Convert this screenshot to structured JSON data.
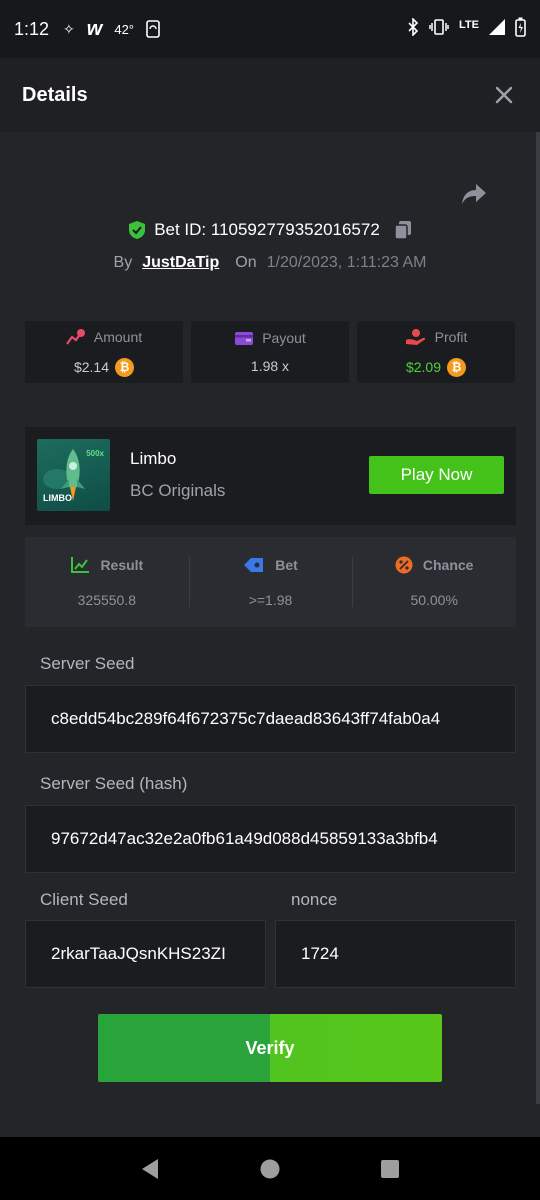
{
  "status_bar": {
    "time": "1:12",
    "temp": "42°",
    "network": "LTE"
  },
  "header": {
    "title": "Details"
  },
  "bet": {
    "id_label": "Bet ID: 110592779352016572",
    "by_label": "By",
    "user": "JustDaTip",
    "on_label": "On",
    "date": "1/20/2023, 1:11:23 AM"
  },
  "stats": [
    {
      "label": "Amount",
      "value": "$2.14",
      "icon": "money-bag-icon",
      "currency_icon": true
    },
    {
      "label": "Payout",
      "value": "1.98 x",
      "icon": "wallet-icon",
      "currency_icon": false
    },
    {
      "label": "Profit",
      "value": "$2.09",
      "icon": "hand-coin-icon",
      "currency_icon": true
    }
  ],
  "game": {
    "name": "Limbo",
    "provider": "BC Originals",
    "thumb_label": "LIMBO",
    "thumb_multiplier": "500x",
    "play_label": "Play Now"
  },
  "results": [
    {
      "label": "Result",
      "value": "325550.8"
    },
    {
      "label": "Bet",
      "value": ">=1.98"
    },
    {
      "label": "Chance",
      "value": "50.00%"
    }
  ],
  "seeds": {
    "server_seed_label": "Server Seed",
    "server_seed": "c8edd54bc289f64f672375c7daead83643ff74fab0a4",
    "server_hash_label": "Server Seed (hash)",
    "server_hash": "97672d47ac32e2a0fb61a49d088d45859133a3bfb4",
    "client_seed_label": "Client Seed",
    "client_seed": "2rkarTaaJQsnKHS23ZI",
    "nonce_label": "nonce",
    "nonce": "1724"
  },
  "verify_label": "Verify",
  "colors": {
    "accent_green": "#45c21a",
    "profit_green": "#4cd137",
    "btc_orange": "#f39a1f"
  }
}
